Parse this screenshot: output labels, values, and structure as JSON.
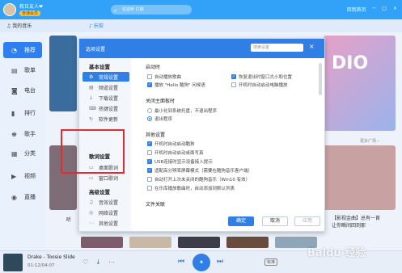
{
  "topbar": {
    "username": "叙日友人❤",
    "vip_label": "普通会员",
    "search_placeholder": "在这听 打歌",
    "right": [
      "回到首页",
      "─",
      "□",
      "×"
    ]
  },
  "tabs": [
    "我的音乐",
    "乐馆"
  ],
  "sidebar": {
    "items": [
      {
        "label": "推荐",
        "icon": "◔"
      },
      {
        "label": "歌单",
        "icon": "▤"
      },
      {
        "label": "电台",
        "icon": "◙"
      },
      {
        "label": "排行",
        "icon": "▮"
      },
      {
        "label": "歌手",
        "icon": "♚"
      },
      {
        "label": "分类",
        "icon": "▦"
      },
      {
        "label": "视频",
        "icon": "▶"
      },
      {
        "label": "直播",
        "icon": "◉"
      }
    ]
  },
  "content": {
    "banner_text": "DIO",
    "more_link": "更多广场 ›",
    "caption_left": "听",
    "caption_right_1": "【影视金曲】总有一首",
    "caption_right_2": "让你瞬间回到那"
  },
  "dialog": {
    "title": "选项设置",
    "search_placeholder": "搜索设置",
    "close_icon": "×",
    "groups": [
      {
        "label": "基本设置",
        "items": [
          {
            "label": "常规设置",
            "icon": "⚙",
            "active": true
          },
          {
            "label": "频道设置",
            "icon": "▤",
            "active": false
          },
          {
            "label": "下载设置",
            "icon": "↓",
            "active": false
          },
          {
            "label": "热键设置",
            "icon": "⌨",
            "active": false
          },
          {
            "label": "软件更新",
            "icon": "↻",
            "active": false
          }
        ]
      },
      {
        "label": "歌词设置",
        "items": [
          {
            "label": "桌面歌词",
            "icon": "▭",
            "active": false
          },
          {
            "label": "窗口歌词",
            "icon": "▭",
            "active": false
          }
        ]
      },
      {
        "label": "高级设置",
        "items": [
          {
            "label": "音效设置",
            "icon": "♫",
            "active": false
          },
          {
            "label": "网络设置",
            "icon": "◎",
            "active": false
          },
          {
            "label": "其他设置",
            "icon": "⋯",
            "active": false
          }
        ]
      }
    ],
    "sections": {
      "startup": {
        "title": "启动时",
        "options": [
          {
            "label": "自动播放歌曲",
            "checked": false
          },
          {
            "label": "恢复退出时窗口大小和位置",
            "checked": true
          },
          {
            "label": "播放 \"Hello 酷狗\" 问候语",
            "checked": true
          },
          {
            "label": "开机时自动启动电脑播放",
            "checked": false
          }
        ]
      },
      "close": {
        "title": "关闭主面板时",
        "options": [
          {
            "label": "最小化到系统托盘，不退出程序",
            "selected": false
          },
          {
            "label": "退出程序",
            "selected": true
          }
        ]
      },
      "other": {
        "title": "其他设置",
        "options": [
          {
            "label": "开机时自动启动酷狗",
            "checked": true
          },
          {
            "label": "开机时自动启动桌面写真",
            "checked": false
          },
          {
            "label": "USB连接时显示设备接入提示",
            "checked": true
          },
          {
            "label": "适配高分辨率屏幕模式（需要在酷狗音乐客户端）",
            "checked": true
          },
          {
            "label": "自动打开上次未关闭的酷狗音乐（Win10 有效）",
            "checked": false
          },
          {
            "label": "在乐库播放歌曲时，自动添加到默认列表",
            "checked": false
          }
        ]
      },
      "file": {
        "title": "文件关联"
      }
    },
    "buttons": {
      "ok": "确定",
      "cancel": "取消",
      "apply": "应用"
    }
  },
  "player": {
    "song": "Drake - Toosie Slide",
    "time": "01:12/04:07",
    "quality_badge": "标准",
    "icons": [
      "♡",
      "↓",
      "⋯",
      "⏮",
      "⏸",
      "⏭"
    ]
  },
  "watermark": "Baidu 经验"
}
